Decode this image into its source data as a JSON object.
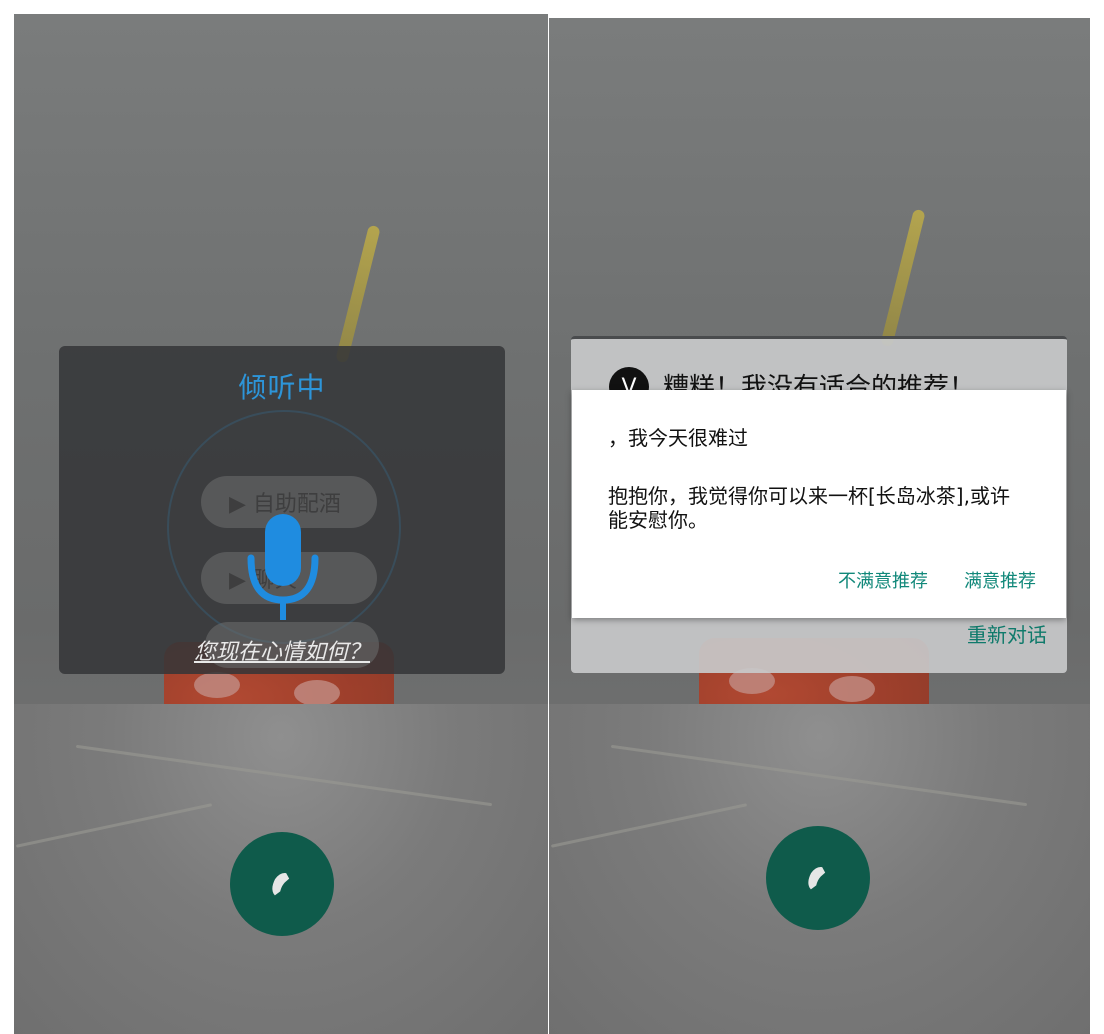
{
  "left_screen": {
    "listening_title": "倾听中",
    "prompt": "您现在心情如何？",
    "mic_icon": "microphone-icon",
    "background_buttons": [
      {
        "label": "▶ 自助配酒"
      },
      {
        "label": "▶ 聊天"
      }
    ],
    "call_icon": "phone-icon"
  },
  "right_screen": {
    "card": {
      "avatar_letter": "V",
      "title": "糟糕！我没有适合的推荐！",
      "restart_label": "重新对话"
    },
    "dialog": {
      "user_message": "，我今天很难过",
      "assistant_message": "抱抱你，我觉得你可以来一杯[长岛冰茶],或许能安慰你。",
      "dislike_label": "不满意推荐",
      "like_label": "满意推荐"
    },
    "call_icon": "phone-icon"
  },
  "colors": {
    "accent_blue": "#2d95d9",
    "call_green": "#0f5b4b",
    "action_teal": "#11887a"
  }
}
